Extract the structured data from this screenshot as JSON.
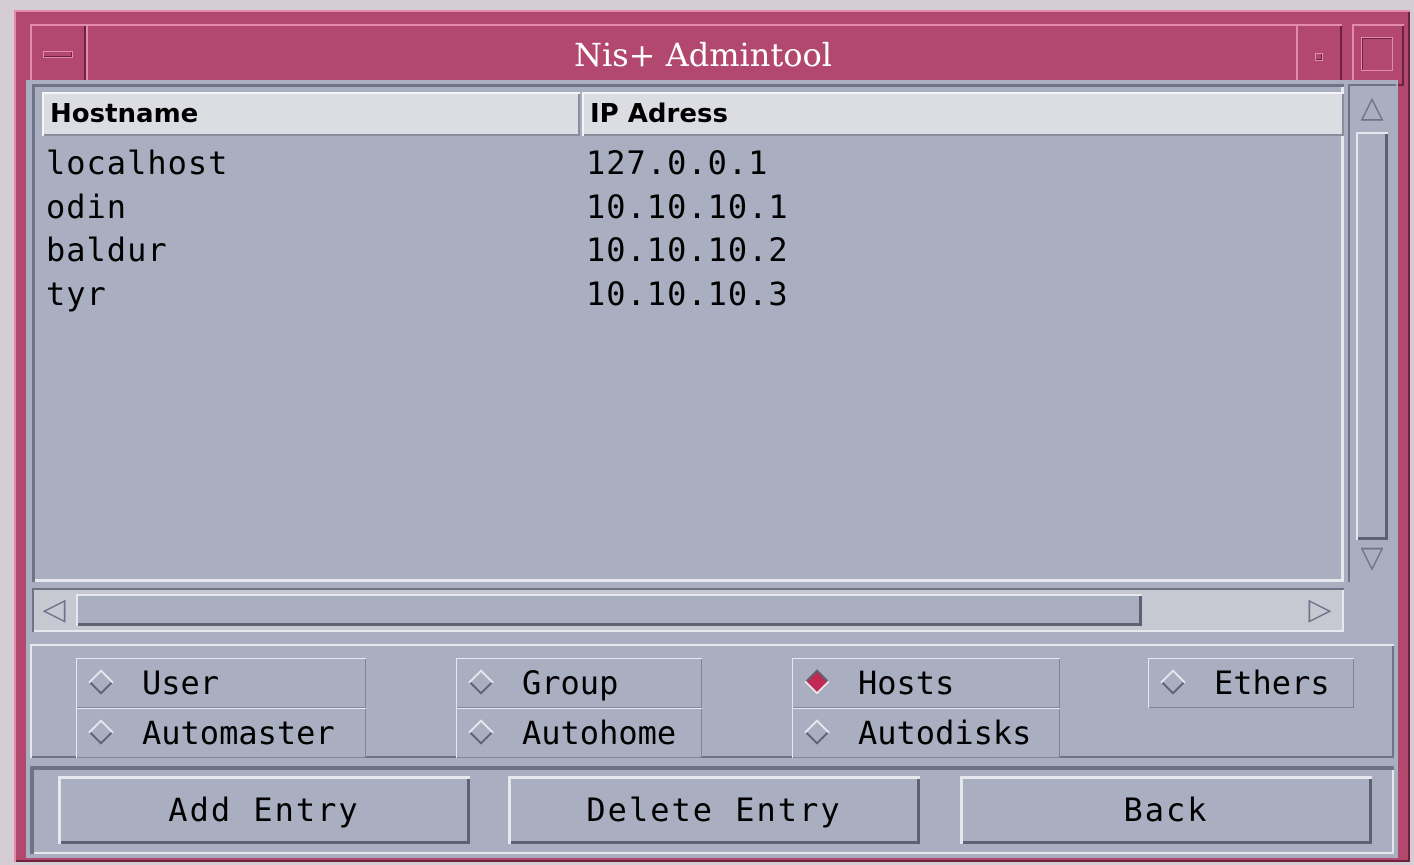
{
  "window": {
    "title": "Nis+ Admintool"
  },
  "table": {
    "columns": [
      "Hostname",
      "IP Adress"
    ],
    "rows": [
      {
        "hostname": "localhost",
        "ip": "127.0.0.1"
      },
      {
        "hostname": "odin",
        "ip": "10.10.10.1"
      },
      {
        "hostname": "baldur",
        "ip": "10.10.10.2"
      },
      {
        "hostname": "tyr",
        "ip": "10.10.10.3"
      }
    ]
  },
  "scrollbars": {
    "horizontal_visible_fraction": 0.84
  },
  "radios": {
    "user": "User",
    "group": "Group",
    "hosts": "Hosts",
    "ethers": "Ethers",
    "automaster": "Automaster",
    "autohome": "Autohome",
    "autodisks": "Autodisks",
    "selected": "Hosts"
  },
  "buttons": {
    "add": "Add Entry",
    "delete": "Delete Entry",
    "back": "Back"
  },
  "colors": {
    "titlebar": "#b3486f",
    "panel": "#a9aec0",
    "selected_radio": "#c02a55"
  }
}
